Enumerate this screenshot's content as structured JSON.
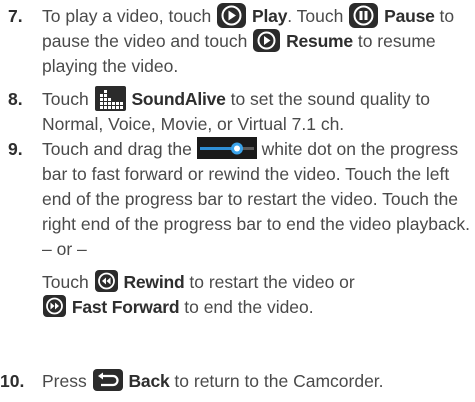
{
  "steps": [
    {
      "number": "7.",
      "parts": {
        "a": "To play a video, touch",
        "play_label": "Play",
        "b": ". Touch",
        "pause_label": "Pause",
        "c": "to",
        "line2a": "pause the video and touch",
        "resume_label": "Resume",
        "line2b": "to resume",
        "line3": "playing the video."
      }
    },
    {
      "number": "8.",
      "parts": {
        "a": "Touch",
        "soundalive_label": "SoundAlive",
        "b": "to set the sound quality to",
        "line2": "Normal, Voice, Movie, or Virtual 7.1 ch."
      }
    },
    {
      "number": "9.",
      "parts": {
        "a": "Touch and drag the",
        "b": "white dot on the progress",
        "line2": "bar to fast forward or rewind the video. Touch the left",
        "line3": "end of the progress bar to restart the video. Touch the",
        "line4": "right end of the progress bar to end the video playback.",
        "or": "– or –",
        "alt1a": "Touch",
        "rewind_label": "Rewind",
        "alt1b": "to restart the video or",
        "ff_label": "Fast Forward",
        "alt2b": "to end the video."
      }
    },
    {
      "number": "10.",
      "parts": {
        "a": "Press",
        "back_label": "Back",
        "b": "to return to the Camcorder."
      }
    }
  ],
  "icons": [
    "play-icon",
    "pause-icon",
    "resume-icon",
    "soundalive-icon",
    "progress-slider-icon",
    "rewind-icon",
    "fast-forward-icon",
    "back-icon"
  ],
  "colors": {
    "icon_dark": "#2b2b2b",
    "icon_blue": "#1f8fd8",
    "text": "#4a4a4a"
  }
}
